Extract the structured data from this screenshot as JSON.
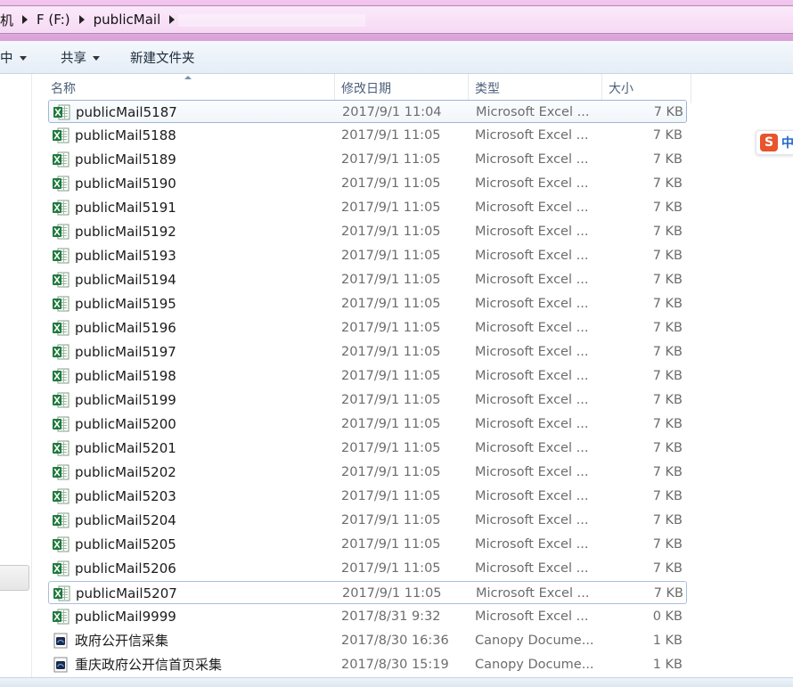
{
  "address": {
    "crumbs": [
      "机",
      "F (F:)",
      "publicMail"
    ]
  },
  "toolbar": {
    "items": [
      {
        "label": "中",
        "dropdown": true
      },
      {
        "label": "共享",
        "dropdown": true
      },
      {
        "label": "新建文件夹",
        "dropdown": false
      }
    ]
  },
  "columns": {
    "name": "名称",
    "date": "修改日期",
    "type": "类型",
    "size": "大小"
  },
  "ime": {
    "badge": "S",
    "mode": "中"
  },
  "files": [
    {
      "name": "publicMail5187",
      "date": "2017/9/1 11:04",
      "type": "Microsoft Excel ...",
      "size": "7 KB",
      "icon": "excel-file-icon"
    },
    {
      "name": "publicMail5188",
      "date": "2017/9/1 11:05",
      "type": "Microsoft Excel ...",
      "size": "7 KB",
      "icon": "excel-file-icon"
    },
    {
      "name": "publicMail5189",
      "date": "2017/9/1 11:05",
      "type": "Microsoft Excel ...",
      "size": "7 KB",
      "icon": "excel-file-icon"
    },
    {
      "name": "publicMail5190",
      "date": "2017/9/1 11:05",
      "type": "Microsoft Excel ...",
      "size": "7 KB",
      "icon": "excel-file-icon"
    },
    {
      "name": "publicMail5191",
      "date": "2017/9/1 11:05",
      "type": "Microsoft Excel ...",
      "size": "7 KB",
      "icon": "excel-file-icon"
    },
    {
      "name": "publicMail5192",
      "date": "2017/9/1 11:05",
      "type": "Microsoft Excel ...",
      "size": "7 KB",
      "icon": "excel-file-icon"
    },
    {
      "name": "publicMail5193",
      "date": "2017/9/1 11:05",
      "type": "Microsoft Excel ...",
      "size": "7 KB",
      "icon": "excel-file-icon"
    },
    {
      "name": "publicMail5194",
      "date": "2017/9/1 11:05",
      "type": "Microsoft Excel ...",
      "size": "7 KB",
      "icon": "excel-file-icon"
    },
    {
      "name": "publicMail5195",
      "date": "2017/9/1 11:05",
      "type": "Microsoft Excel ...",
      "size": "7 KB",
      "icon": "excel-file-icon"
    },
    {
      "name": "publicMail5196",
      "date": "2017/9/1 11:05",
      "type": "Microsoft Excel ...",
      "size": "7 KB",
      "icon": "excel-file-icon"
    },
    {
      "name": "publicMail5197",
      "date": "2017/9/1 11:05",
      "type": "Microsoft Excel ...",
      "size": "7 KB",
      "icon": "excel-file-icon"
    },
    {
      "name": "publicMail5198",
      "date": "2017/9/1 11:05",
      "type": "Microsoft Excel ...",
      "size": "7 KB",
      "icon": "excel-file-icon"
    },
    {
      "name": "publicMail5199",
      "date": "2017/9/1 11:05",
      "type": "Microsoft Excel ...",
      "size": "7 KB",
      "icon": "excel-file-icon"
    },
    {
      "name": "publicMail5200",
      "date": "2017/9/1 11:05",
      "type": "Microsoft Excel ...",
      "size": "7 KB",
      "icon": "excel-file-icon"
    },
    {
      "name": "publicMail5201",
      "date": "2017/9/1 11:05",
      "type": "Microsoft Excel ...",
      "size": "7 KB",
      "icon": "excel-file-icon"
    },
    {
      "name": "publicMail5202",
      "date": "2017/9/1 11:05",
      "type": "Microsoft Excel ...",
      "size": "7 KB",
      "icon": "excel-file-icon"
    },
    {
      "name": "publicMail5203",
      "date": "2017/9/1 11:05",
      "type": "Microsoft Excel ...",
      "size": "7 KB",
      "icon": "excel-file-icon"
    },
    {
      "name": "publicMail5204",
      "date": "2017/9/1 11:05",
      "type": "Microsoft Excel ...",
      "size": "7 KB",
      "icon": "excel-file-icon"
    },
    {
      "name": "publicMail5205",
      "date": "2017/9/1 11:05",
      "type": "Microsoft Excel ...",
      "size": "7 KB",
      "icon": "excel-file-icon"
    },
    {
      "name": "publicMail5206",
      "date": "2017/9/1 11:05",
      "type": "Microsoft Excel ...",
      "size": "7 KB",
      "icon": "excel-file-icon"
    },
    {
      "name": "publicMail5207",
      "date": "2017/9/1 11:05",
      "type": "Microsoft Excel ...",
      "size": "7 KB",
      "icon": "excel-file-icon"
    },
    {
      "name": "publicMail9999",
      "date": "2017/8/31 9:32",
      "type": "Microsoft Excel ...",
      "size": "0 KB",
      "icon": "excel-file-icon"
    },
    {
      "name": "政府公开信采集",
      "date": "2017/8/30 16:36",
      "type": "Canopy Docume...",
      "size": "1 KB",
      "icon": "canopy-document-icon"
    },
    {
      "name": "重庆政府公开信首页采集",
      "date": "2017/8/30 15:19",
      "type": "Canopy Docume...",
      "size": "1 KB",
      "icon": "canopy-document-icon"
    }
  ]
}
